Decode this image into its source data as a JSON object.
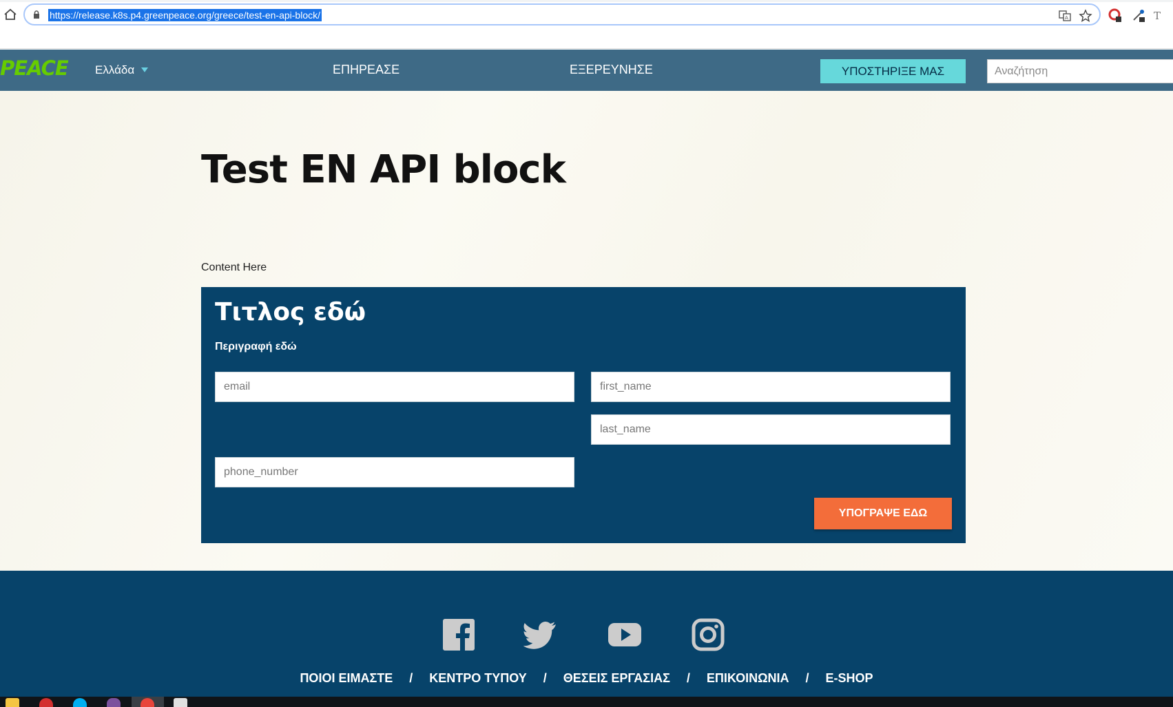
{
  "browser": {
    "url": "https://release.k8s.p4.greenpeace.org/greece/test-en-api-block/"
  },
  "header": {
    "logo_text": "PEACE",
    "country": "Ελλάδα",
    "nav": [
      "ΕΠΗΡΕΑΣΕ",
      "ΕΞΕΡΕΥΝΗΣΕ"
    ],
    "support_label": "ΥΠΟΣΤΗΡΙΞΕ ΜΑΣ",
    "search_placeholder": "Αναζήτηση"
  },
  "main": {
    "title": "Test EN API block",
    "content": "Content Here"
  },
  "form": {
    "title": "Τιτλος εδώ",
    "description": "Περιγραφή εδώ",
    "fields": {
      "email": "email",
      "first_name": "first_name",
      "last_name": "last_name",
      "phone_number": "phone_number"
    },
    "submit_label": "ΥΠΟΓΡΑΨΕ ΕΔΩ"
  },
  "footer": {
    "social": [
      "facebook-icon",
      "twitter-icon",
      "youtube-icon",
      "instagram-icon"
    ],
    "links": [
      "ΠΟΙΟΙ ΕΙΜΑΣΤΕ",
      "ΚΕΝΤΡΟ ΤΥΠΟΥ",
      "ΘΕΣΕΙΣ ΕΡΓΑΣΙΑΣ",
      "ΕΠΙΚΟΙΝΩΝΙΑ",
      "E-SHOP"
    ],
    "separator": "/"
  },
  "colors": {
    "header_bg": "#3e6a86",
    "brand_green": "#66cc00",
    "form_bg": "#07436a",
    "support_button": "#66d8db",
    "submit_button": "#f36d3a"
  }
}
